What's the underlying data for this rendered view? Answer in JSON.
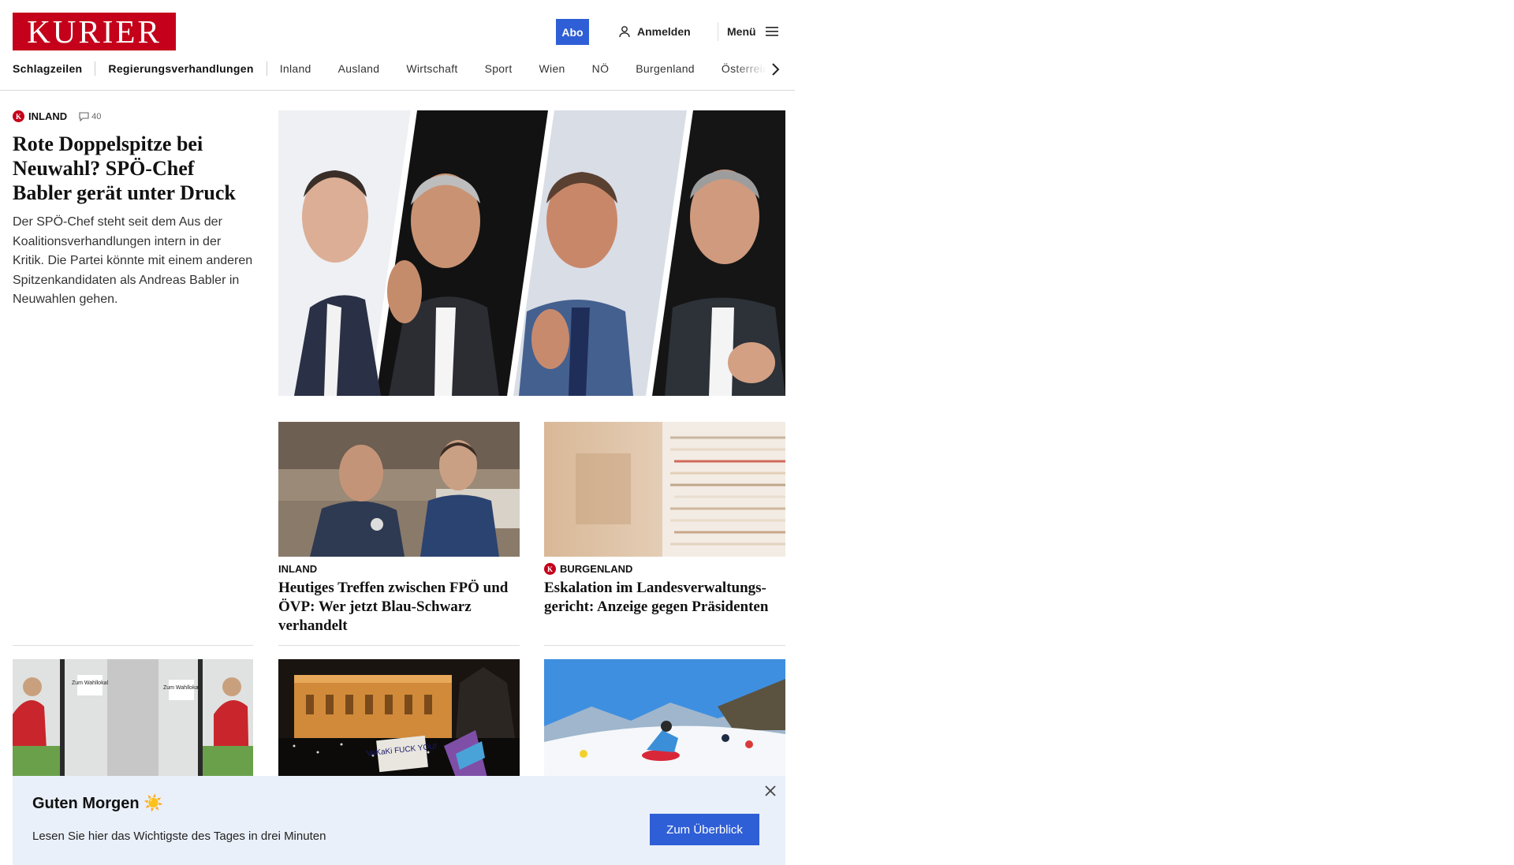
{
  "header": {
    "logo": "KURIER",
    "abo_label": "Abo",
    "login_label": "Anmelden",
    "menu_label": "Menü"
  },
  "nav": {
    "items": [
      "Schlagzeilen",
      "Regierungsverhandlungen",
      "Inland",
      "Ausland",
      "Wirtschaft",
      "Sport",
      "Wien",
      "NÖ",
      "Burgenland",
      "Österreich"
    ]
  },
  "lead": {
    "category": "INLAND",
    "comments": "40",
    "title": "Rote Doppelspitze bei Neuwahl? SPÖ-Chef Babler gerät unter Druck",
    "teaser": "Der SPÖ-Chef steht seit dem Aus der Koalitionsverhandlungen intern in der Kritik. Die Partei könnte mit einem anderen Spitzenkandidaten als Andreas Babler in Neuwahlen gehen."
  },
  "cards": [
    {
      "category": "INLAND",
      "title": "Heutiges Treffen zwischen FPÖ und ÖVP: Wer jetzt Blau-Schwarz verhandelt"
    },
    {
      "category": "BURGENLAND",
      "title": "Eskalation im Landesverwaltungs-gericht: Anzeige gegen Präsidenten"
    }
  ],
  "photo_signs": [
    "Zum Wahllokal",
    "Zum Wahllokal"
  ],
  "protest_sign": "VoKaKi FUCK YOU!",
  "banner": {
    "title": "Guten Morgen ☀️",
    "text": "Lesen Sie hier das Wichtigste des Tages in drei Minuten",
    "button": "Zum Überblick"
  },
  "colors": {
    "brand_red": "#c4001a",
    "accent_blue": "#2f5fd6",
    "banner_bg": "#eaf0f9"
  }
}
